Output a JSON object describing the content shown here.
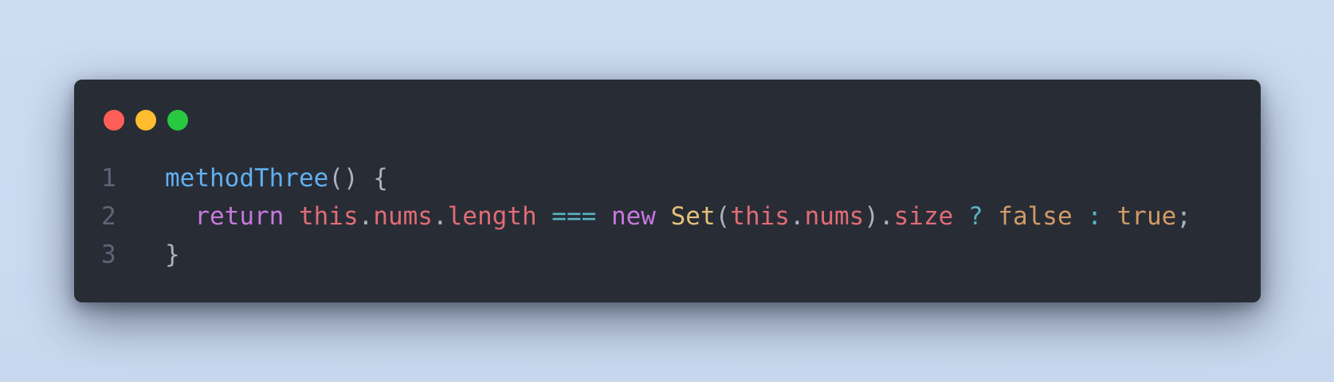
{
  "window": {
    "controls": [
      {
        "name": "close",
        "color": "#ff5f57"
      },
      {
        "name": "minimize",
        "color": "#febc2e"
      },
      {
        "name": "maximize",
        "color": "#28c840"
      }
    ]
  },
  "code": {
    "lines": [
      {
        "number": "1",
        "tokens": [
          {
            "text": "methodThree",
            "color": "#61afef"
          },
          {
            "text": "() {",
            "color": "#abb2bf"
          }
        ]
      },
      {
        "number": "2",
        "tokens": [
          {
            "text": "  ",
            "color": "#abb2bf"
          },
          {
            "text": "return",
            "color": "#c678dd"
          },
          {
            "text": " ",
            "color": "#abb2bf"
          },
          {
            "text": "this",
            "color": "#e06c75"
          },
          {
            "text": ".",
            "color": "#abb2bf"
          },
          {
            "text": "nums",
            "color": "#e06c75"
          },
          {
            "text": ".",
            "color": "#abb2bf"
          },
          {
            "text": "length",
            "color": "#e06c75"
          },
          {
            "text": " ",
            "color": "#abb2bf"
          },
          {
            "text": "===",
            "color": "#56b6c2"
          },
          {
            "text": " ",
            "color": "#abb2bf"
          },
          {
            "text": "new",
            "color": "#c678dd"
          },
          {
            "text": " ",
            "color": "#abb2bf"
          },
          {
            "text": "Set",
            "color": "#e5c07b"
          },
          {
            "text": "(",
            "color": "#abb2bf"
          },
          {
            "text": "this",
            "color": "#e06c75"
          },
          {
            "text": ".",
            "color": "#abb2bf"
          },
          {
            "text": "nums",
            "color": "#e06c75"
          },
          {
            "text": ").",
            "color": "#abb2bf"
          },
          {
            "text": "size",
            "color": "#e06c75"
          },
          {
            "text": " ",
            "color": "#abb2bf"
          },
          {
            "text": "?",
            "color": "#56b6c2"
          },
          {
            "text": " ",
            "color": "#abb2bf"
          },
          {
            "text": "false",
            "color": "#d19a66"
          },
          {
            "text": " ",
            "color": "#abb2bf"
          },
          {
            "text": ":",
            "color": "#56b6c2"
          },
          {
            "text": " ",
            "color": "#abb2bf"
          },
          {
            "text": "true",
            "color": "#d19a66"
          },
          {
            "text": ";",
            "color": "#abb2bf"
          }
        ]
      },
      {
        "number": "3",
        "tokens": [
          {
            "text": "}",
            "color": "#abb2bf"
          }
        ]
      }
    ]
  }
}
